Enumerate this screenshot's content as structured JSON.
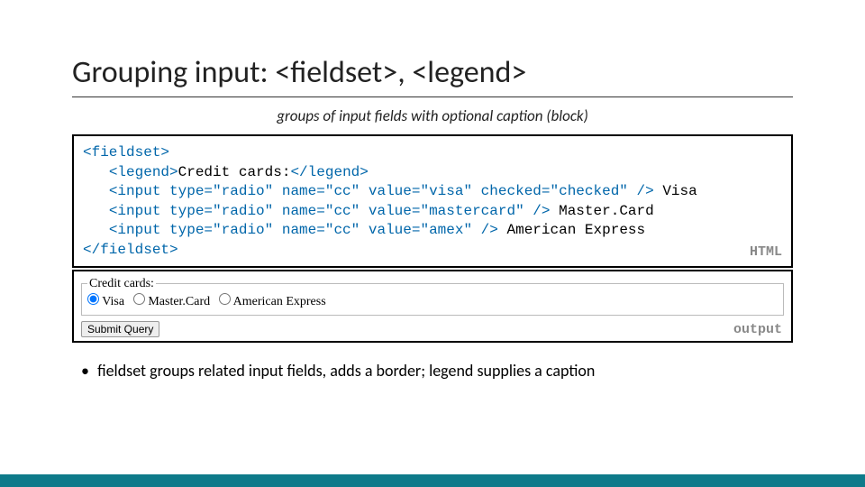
{
  "title": "Grouping input: <fieldset>, <legend>",
  "subtitle": "groups of input fields with optional caption (block)",
  "code": {
    "line1_open": "<fieldset>",
    "line2_legend_open": "<legend>",
    "line2_text": "Credit cards:",
    "line2_legend_close": "</legend>",
    "line3": "<input type=\"radio\" name=\"cc\" value=\"visa\" checked=\"checked\" />",
    "line3_text": " Visa",
    "line4": "<input type=\"radio\" name=\"cc\" value=\"mastercard\" />",
    "line4_text": " Master.Card",
    "line5": "<input type=\"radio\" name=\"cc\" value=\"amex\" />",
    "line5_text": " American Express",
    "line6_close": "</fieldset>",
    "label": "HTML"
  },
  "output": {
    "legend": "Credit cards:",
    "opt1": "Visa",
    "opt2": "Master.Card",
    "opt3": "American Express",
    "submit": "Submit Query",
    "label": "output"
  },
  "bullet": "fieldset groups related input fields, adds a border; legend supplies a caption"
}
